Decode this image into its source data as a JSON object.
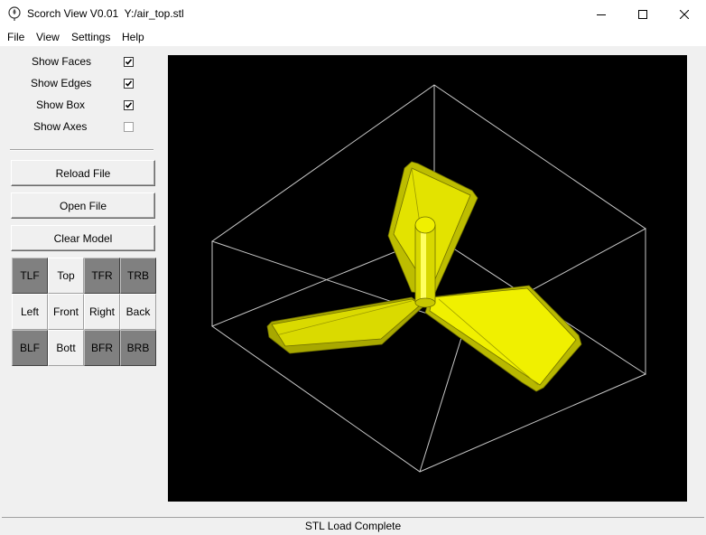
{
  "window": {
    "app_name": "Scorch View V0.01",
    "file_path": "Y:/air_top.stl",
    "icon": "scorch-app-icon"
  },
  "window_controls": {
    "minimize_icon": "minimize-icon",
    "maximize_icon": "maximize-icon",
    "close_icon": "close-icon"
  },
  "menu": {
    "file": "File",
    "view": "View",
    "settings": "Settings",
    "help": "Help"
  },
  "options": {
    "show_faces": {
      "label": "Show Faces",
      "checked": true
    },
    "show_edges": {
      "label": "Show Edges",
      "checked": true
    },
    "show_box": {
      "label": "Show Box",
      "checked": true
    },
    "show_axes": {
      "label": "Show Axes",
      "checked": false
    }
  },
  "actions": {
    "reload": "Reload File",
    "open": "Open File",
    "clear": "Clear Model"
  },
  "view_buttons": [
    [
      "TLF",
      "Top",
      "TFR",
      "TRB"
    ],
    [
      "Left",
      "Front",
      "Right",
      "Back"
    ],
    [
      "BLF",
      "Bott",
      "BFR",
      "BRB"
    ]
  ],
  "viewport": {
    "background": "#000000",
    "model_color": "#e6e600",
    "box_color": "#c8c8c8",
    "model": "three-blade propeller"
  },
  "status": "STL Load Complete"
}
